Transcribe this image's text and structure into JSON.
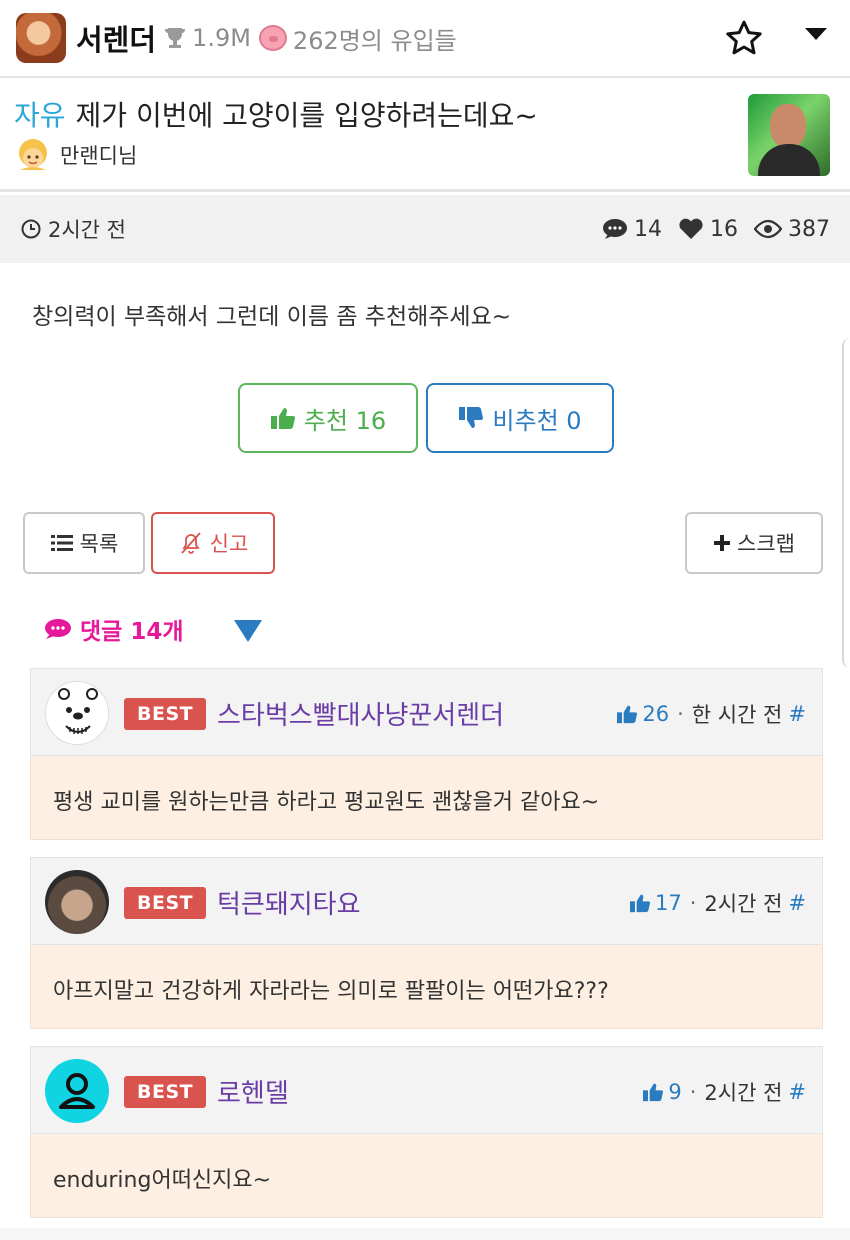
{
  "header": {
    "board_name": "서렌더",
    "trophy_count": "1.9M",
    "visitors": "262명의 유입들",
    "icons": [
      "board-avatar",
      "trophy-icon",
      "pig-icon",
      "star-icon",
      "caret-down-icon"
    ]
  },
  "post": {
    "category": "자유",
    "title": "제가 이번에 고양이를 입양하려는데요~",
    "author": "만랜디님",
    "time": "2시간 전",
    "comments": "14",
    "likes": "16",
    "views": "387",
    "body": "창의력이 부족해서 그런데 이름 좀 추천해주세요~",
    "upvote_label": "추천 16",
    "downvote_label": "비추천 0"
  },
  "actions": {
    "list_label": "목록",
    "report_label": "신고",
    "scrap_label": "스크랩"
  },
  "comments_header": "댓글 14개",
  "comments": [
    {
      "badge": "BEST",
      "name": "스타벅스빨대사냥꾼서렌더",
      "likes": "26",
      "time": "한 시간 전",
      "hash": "#",
      "text": "평생 교미를 원하는만큼 하라고 평교원도 괜찮을거 같아요~"
    },
    {
      "badge": "BEST",
      "name": "턱큰돼지타요",
      "likes": "17",
      "time": "2시간 전",
      "hash": "#",
      "text": "아프지말고 건강하게 자라라는 의미로 팔팔이는 어떤가요???"
    },
    {
      "badge": "BEST",
      "name": "로헨델",
      "likes": "9",
      "time": "2시간 전",
      "hash": "#",
      "text": "enduring어떠신지요~"
    }
  ],
  "colors": {
    "category": "#2aa7d6",
    "upvote": "#5cb85c",
    "downvote": "#2a7bc0",
    "report": "#d9534f",
    "comment_header": "#e6199b",
    "best_badge": "#d9534f",
    "nickname": "#6a3da6",
    "comment_body_bg": "#fdf0e3"
  }
}
